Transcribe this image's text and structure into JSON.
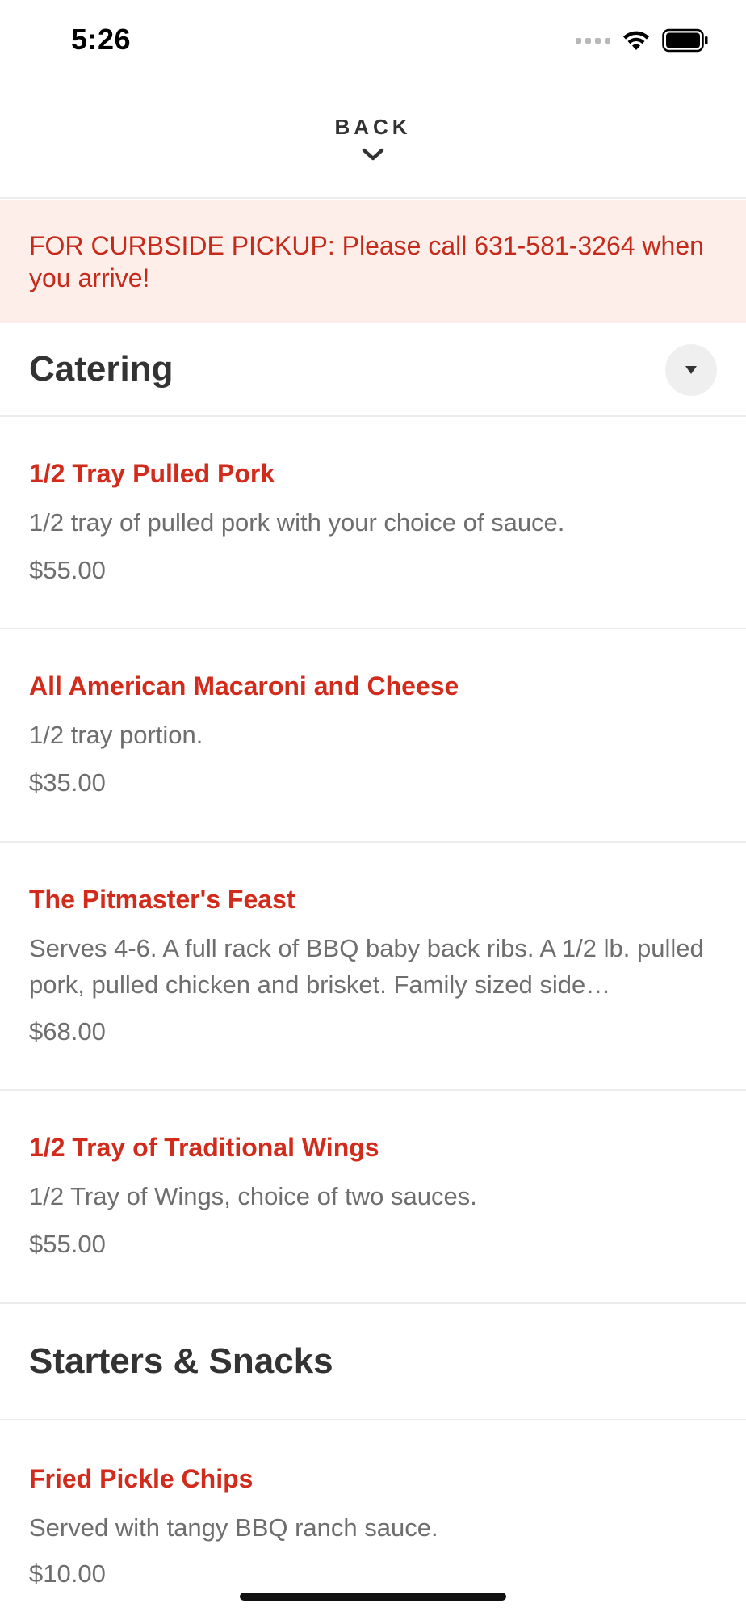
{
  "status_bar": {
    "time": "5:26"
  },
  "header": {
    "back_label": "BACK"
  },
  "banner": {
    "text": "FOR CURBSIDE PICKUP: Please call 631-581-3264 when you arrive!"
  },
  "sections": [
    {
      "title": "Catering",
      "items": [
        {
          "name": "1/2 Tray Pulled Pork",
          "description": "1/2 tray of pulled pork with your choice of sauce.",
          "price": "$55.00"
        },
        {
          "name": "All American Macaroni and Cheese",
          "description": "1/2 tray portion.",
          "price": "$35.00"
        },
        {
          "name": "The Pitmaster's Feast",
          "description": "Serves 4-6. A full rack of BBQ baby back ribs. A 1/2 lb. pulled pork, pulled chicken and brisket. Family sized side…",
          "price": "$68.00"
        },
        {
          "name": "1/2 Tray of Traditional Wings",
          "description": "1/2 Tray of Wings, choice of two sauces.",
          "price": "$55.00"
        }
      ]
    },
    {
      "title": "Starters & Snacks",
      "items": [
        {
          "name": "Fried Pickle Chips",
          "description": "Served with tangy BBQ ranch sauce.",
          "price": "$10.00"
        }
      ]
    }
  ],
  "colors": {
    "accent": "#d22b1b",
    "banner_bg": "#fdeeea",
    "banner_text": "#c52a1a"
  }
}
